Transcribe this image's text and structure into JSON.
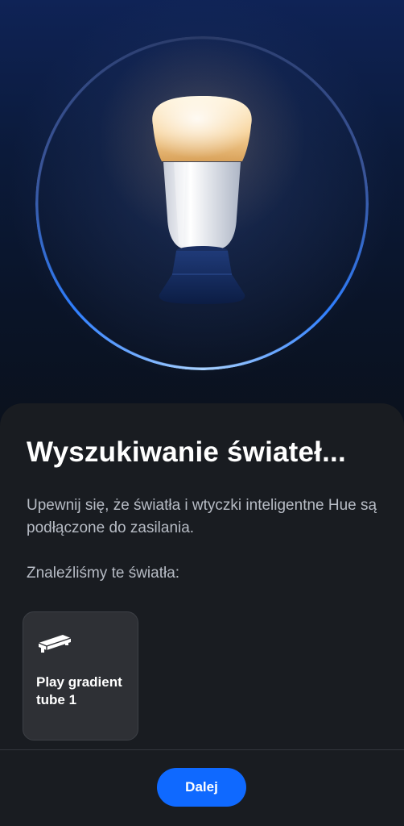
{
  "hero": {
    "illustration_icon": "hue-bulb-icon",
    "ring_color": "#2f7fff"
  },
  "sheet": {
    "title": "Wyszukiwanie świateł...",
    "description": "Upewnij się, że światła i wtyczki inteligentne Hue są podłączone do zasilania.",
    "found_label": "Znaleźliśmy te światła:",
    "lights": [
      {
        "name": "Play gradient tube 1",
        "icon": "gradient-tube-icon"
      }
    ]
  },
  "footer": {
    "next_label": "Dalej",
    "accent": "#0f69ff"
  }
}
